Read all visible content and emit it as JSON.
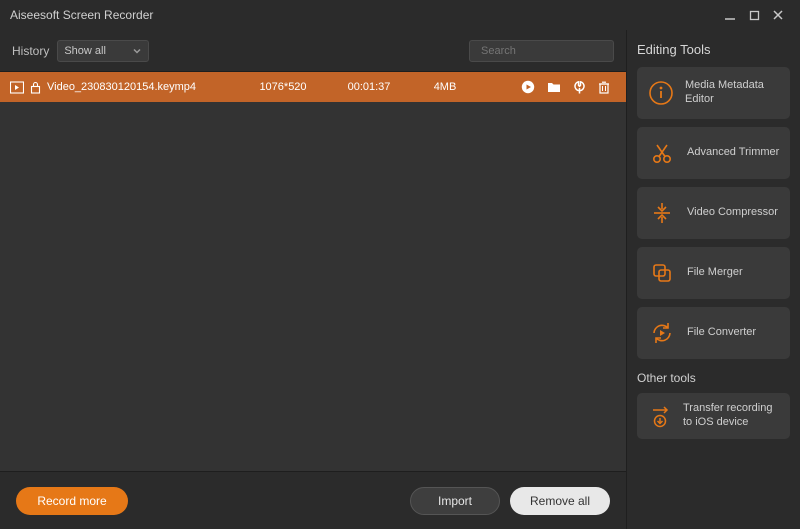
{
  "title": "Aiseesoft Screen Recorder",
  "toolbar": {
    "history_label": "History",
    "dropdown_value": "Show all",
    "search_placeholder": "Search"
  },
  "file": {
    "name": "Video_230830120154.keymp4",
    "resolution": "1076*520",
    "duration": "00:01:37",
    "size": "4MB"
  },
  "buttons": {
    "record_more": "Record more",
    "import": "Import",
    "remove_all": "Remove all"
  },
  "right": {
    "editing_title": "Editing Tools",
    "tools": {
      "metadata": "Media Metadata Editor",
      "trimmer": "Advanced Trimmer",
      "compressor": "Video Compressor",
      "merger": "File Merger",
      "converter": "File Converter"
    },
    "other_title": "Other tools",
    "transfer": "Transfer recording to iOS device"
  },
  "colors": {
    "accent": "#e67817",
    "row": "#c26428"
  }
}
